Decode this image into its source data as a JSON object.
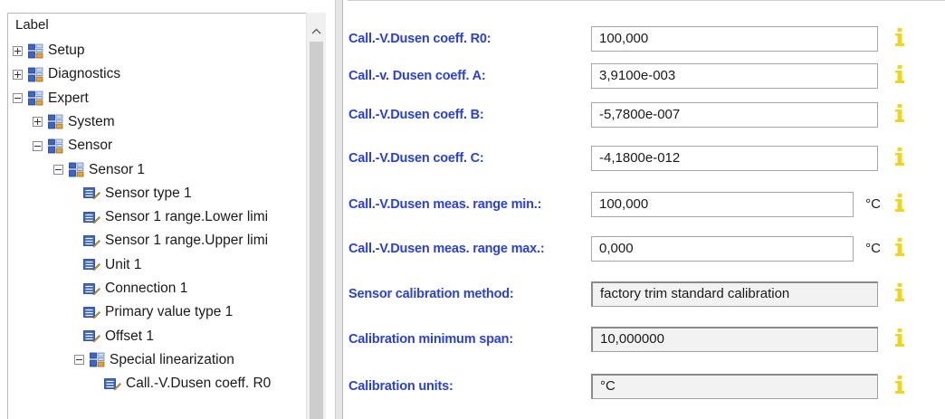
{
  "tree": {
    "header": "Label",
    "items": [
      {
        "label": "Setup",
        "kind": "folder",
        "expander": "plus",
        "depth": 0
      },
      {
        "label": "Diagnostics",
        "kind": "folder",
        "expander": "plus",
        "depth": 0
      },
      {
        "label": "Expert",
        "kind": "folder",
        "expander": "minus",
        "depth": 0
      },
      {
        "label": "System",
        "kind": "folder",
        "expander": "plus",
        "depth": 1
      },
      {
        "label": "Sensor",
        "kind": "folder",
        "expander": "minus",
        "depth": 1
      },
      {
        "label": "Sensor 1",
        "kind": "folder",
        "expander": "minus",
        "depth": 2
      },
      {
        "label": "Sensor type 1",
        "kind": "param",
        "depth": 3
      },
      {
        "label": "Sensor 1 range.Lower limi",
        "kind": "param",
        "depth": 3
      },
      {
        "label": "Sensor 1 range.Upper limi",
        "kind": "param",
        "depth": 3
      },
      {
        "label": "Unit 1",
        "kind": "param",
        "depth": 3
      },
      {
        "label": "Connection 1",
        "kind": "param",
        "depth": 3
      },
      {
        "label": "Primary value type 1",
        "kind": "param",
        "depth": 3
      },
      {
        "label": "Offset 1",
        "kind": "param",
        "depth": 3
      },
      {
        "label": "Special linearization",
        "kind": "folder",
        "expander": "minus",
        "depth": 3
      },
      {
        "label": "Call.-V.Dusen coeff. R0",
        "kind": "param",
        "depth": 4
      }
    ]
  },
  "params": [
    {
      "label": "Call.-V.Dusen coeff. R0:",
      "value": "100,000",
      "unit": "",
      "readonly": false
    },
    {
      "label": "Call.-v. Dusen coeff. A:",
      "value": "3,9100e-003",
      "unit": "",
      "readonly": false
    },
    {
      "label": "Call.-V.Dusen coeff. B:",
      "value": "-5,7800e-007",
      "unit": "",
      "readonly": false
    },
    {
      "label": "Call.-V.Dusen coeff. C:",
      "value": "-4,1800e-012",
      "unit": "",
      "readonly": false
    },
    {
      "label": "Call.-V.Dusen meas. range min.:",
      "value": "100,000",
      "unit": "°C",
      "readonly": false
    },
    {
      "label": "Call.-V.Dusen meas. range max.:",
      "value": "0,000",
      "unit": "°C",
      "readonly": false
    },
    {
      "label": "Sensor calibration method:",
      "value": "factory trim standard calibration",
      "unit": "",
      "readonly": true
    },
    {
      "label": "Calibration minimum span:",
      "value": "10,000000",
      "unit": "",
      "readonly": true
    },
    {
      "label": "Calibration units:",
      "value": "°C",
      "unit": "",
      "readonly": true
    }
  ],
  "colors": {
    "label_blue": "#2b41d6",
    "info_icon": "#f2d41a"
  },
  "icons": {
    "folder": "device-group-icon",
    "param": "parameter-icon",
    "info": "info-icon"
  }
}
